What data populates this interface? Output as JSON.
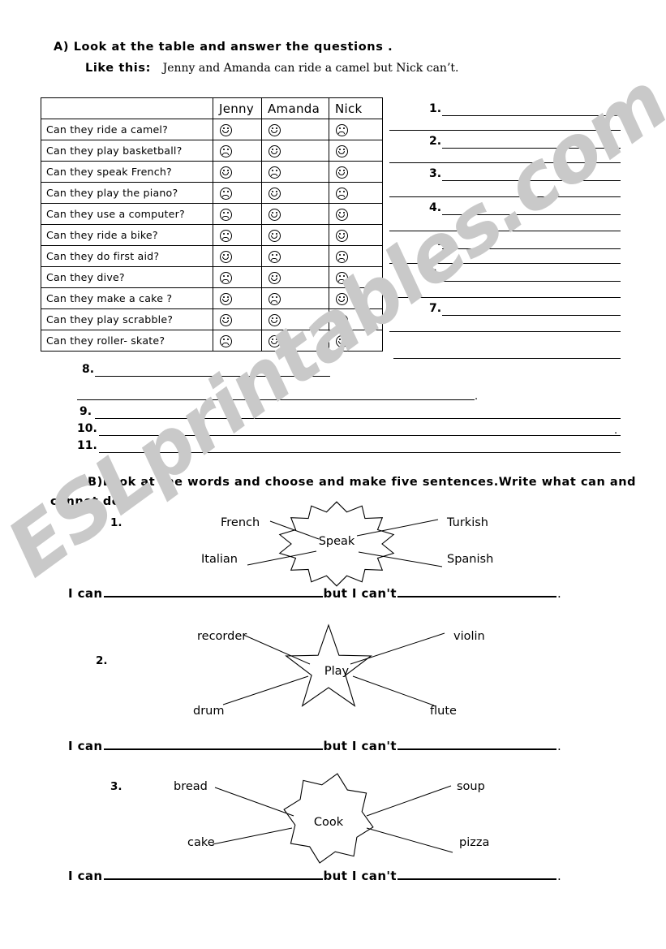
{
  "watermark": {
    "text": "ESLprintables.com"
  },
  "sectionA": {
    "heading": "A) Look at the table and answer the questions .",
    "example_label": "Like this:",
    "example_text": "Jenny and Amanda can ride  a camel but Nick can’t.",
    "table": {
      "columns": [
        "",
        "Jenny",
        "Amanda",
        "Nick"
      ],
      "rows": [
        {
          "question": "Can they ride a camel?",
          "jenny": "happy",
          "amanda": "happy",
          "nick": "sad"
        },
        {
          "question": "Can they play basketball?",
          "jenny": "sad",
          "amanda": "happy",
          "nick": "happy"
        },
        {
          "question": "Can they speak French?",
          "jenny": "happy",
          "amanda": "sad",
          "nick": "happy"
        },
        {
          "question": "Can they play the piano?",
          "jenny": "sad",
          "amanda": "happy",
          "nick": "sad"
        },
        {
          "question": "Can they use a computer?",
          "jenny": "sad",
          "amanda": "happy",
          "nick": "happy"
        },
        {
          "question": "Can they ride a bike?",
          "jenny": "sad",
          "amanda": "happy",
          "nick": "happy"
        },
        {
          "question": "Can they do first aid?",
          "jenny": "happy",
          "amanda": "sad",
          "nick": "sad"
        },
        {
          "question": "Can they dive?",
          "jenny": "sad",
          "amanda": "happy",
          "nick": "sad"
        },
        {
          "question": "Can they make a cake ?",
          "jenny": "happy",
          "amanda": "sad",
          "nick": "happy"
        },
        {
          "question": "Can they play scrabble?",
          "jenny": "happy",
          "amanda": "happy",
          "nick": "sad"
        },
        {
          "question": "Can they roller- skate?",
          "jenny": "sad",
          "amanda": "happy",
          "nick": "happy"
        }
      ]
    },
    "answer_numbers_right": [
      "1.",
      "2.",
      "3.",
      "4.",
      "5.",
      "6.",
      "7."
    ],
    "answer_numbers_low": [
      "8.",
      "9.",
      "10.",
      "11."
    ],
    "period": "."
  },
  "sectionB": {
    "heading_line1": "B)Look at the words and choose and make five sentences.Write what can and",
    "heading_line2": "cannot do.",
    "groups": [
      {
        "number": "1.",
        "shape": "starburst",
        "center": "Speak",
        "words": {
          "top_left": "French",
          "top_right": "Turkish",
          "bottom_left": "Italian",
          "bottom_right": "Spanish"
        }
      },
      {
        "number": "2.",
        "shape": "star5",
        "center": "Play",
        "words": {
          "top_left": "recorder",
          "top_right": "violin",
          "bottom_left": "drum",
          "bottom_right": "flute"
        }
      },
      {
        "number": "3.",
        "shape": "star8",
        "center": "Cook",
        "words": {
          "top_left": "bread",
          "top_right": "soup",
          "bottom_left": "cake",
          "bottom_right": "pizza"
        }
      }
    ],
    "sentence_line": {
      "prefix": "I can",
      "middle": "but I can't",
      "suffix": "."
    }
  }
}
